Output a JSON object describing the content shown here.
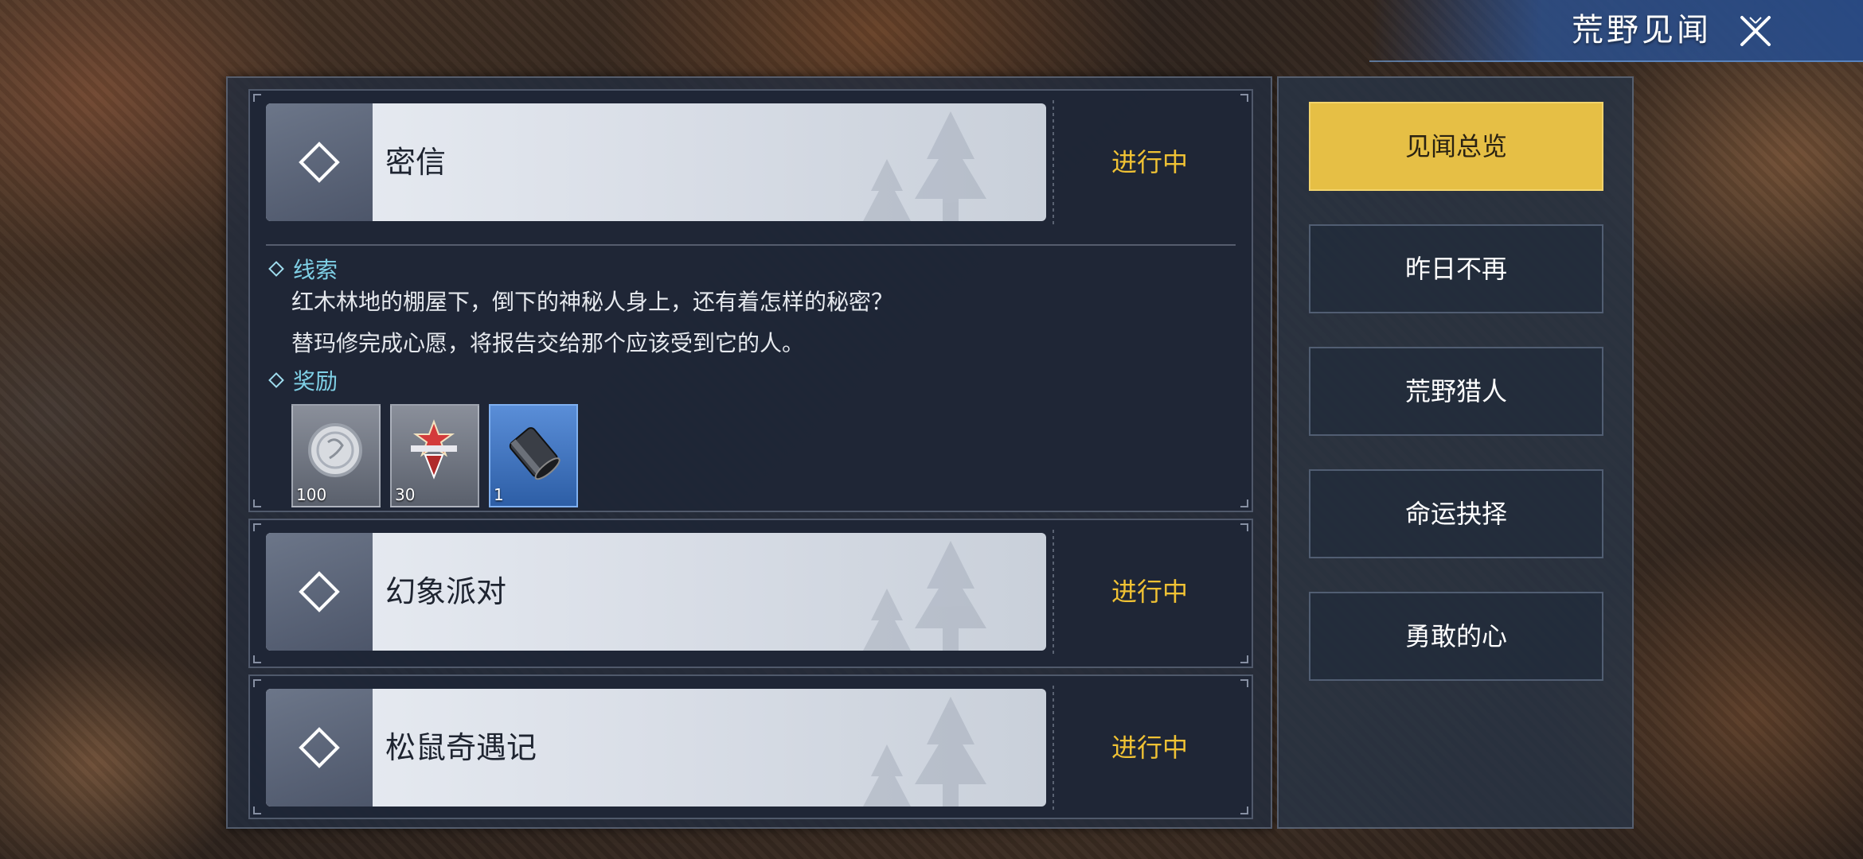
{
  "window": {
    "title": "荒野见闻"
  },
  "quests": [
    {
      "title": "密信",
      "status": "进行中",
      "clue_label": "线索",
      "clue_lines": [
        "红木林地的棚屋下，倒下的神秘人身上，还有着怎样的秘密？",
        "替玛修完成心愿，将报告交给那个应该受到它的人。"
      ],
      "reward_label": "奖励",
      "rewards": [
        {
          "icon": "silver-coin-icon",
          "count": "100"
        },
        {
          "icon": "medal-badge-icon",
          "count": "30"
        },
        {
          "icon": "metal-pipe-icon",
          "count": "1"
        }
      ]
    },
    {
      "title": "幻象派对",
      "status": "进行中"
    },
    {
      "title": "松鼠奇遇记",
      "status": "进行中"
    }
  ],
  "tabs": [
    {
      "label": "见闻总览",
      "active": true
    },
    {
      "label": "昨日不再",
      "active": false
    },
    {
      "label": "荒野猎人",
      "active": false
    },
    {
      "label": "命运抉择",
      "active": false
    },
    {
      "label": "勇敢的心",
      "active": false
    }
  ],
  "colors": {
    "status": "#f0c234",
    "active_tab": "#e6bf45",
    "section_label": "#7fd0e6"
  }
}
